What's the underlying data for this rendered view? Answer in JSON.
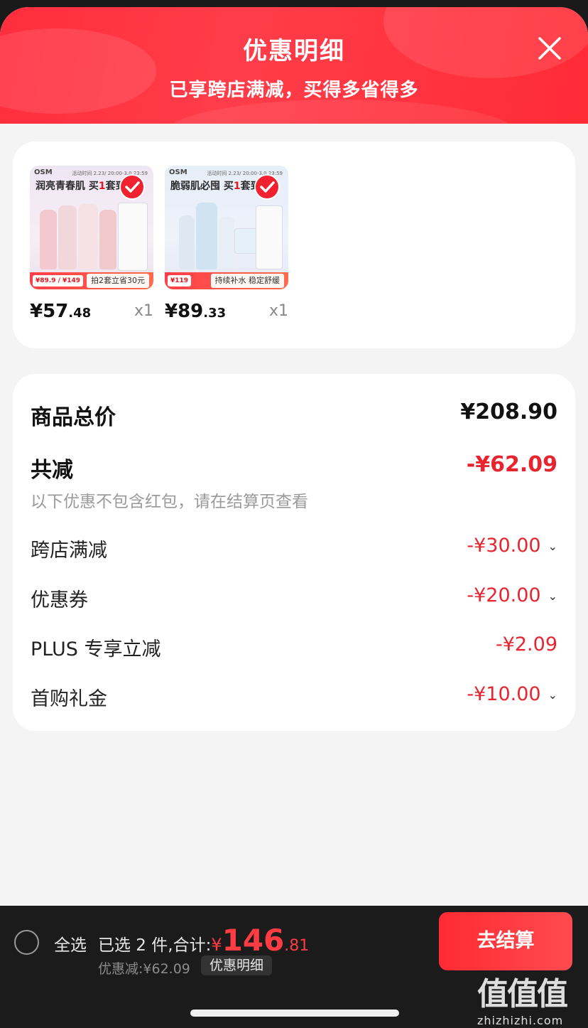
{
  "header": {
    "title": "优惠明细",
    "subtitle": "已享跨店满减，买得多省得多"
  },
  "products": [
    {
      "thumb": {
        "brand": "OSM",
        "date_text": "活动时间 2.23/ 20:00-3.0 23:59",
        "headline": "润亮青春肌 买",
        "headline_num": "1",
        "headline_tail": "套到手",
        "price_tag": "¥89.9 / ¥149",
        "sub_tag": "拍2套立省30元"
      },
      "price_int": "¥57",
      "price_dec": ".48",
      "qty": "x1",
      "selected": true
    },
    {
      "thumb": {
        "brand": "OSM",
        "date_text": "活动时间 2.23/ 20:00-3.0 23:59",
        "headline": "脆弱肌必囤 买",
        "headline_num": "1",
        "headline_tail": "套到手",
        "price_tag": "¥119",
        "sub_tag": "持续补水 稳定舒缓"
      },
      "price_int": "¥89",
      "price_dec": ".33",
      "qty": "x1",
      "selected": true
    }
  ],
  "summary": {
    "total_label": "商品总价",
    "total_value": "¥208.90",
    "reduce_label": "共减",
    "reduce_value": "-¥62.09",
    "note": "以下优惠不包含红包，请在结算页查看",
    "items": [
      {
        "label": "跨店满减",
        "value": "-¥30.00",
        "expandable": true
      },
      {
        "label": "优惠券",
        "value": "-¥20.00",
        "expandable": true
      },
      {
        "label": "PLUS 专享立减",
        "value": "-¥2.09",
        "expandable": false
      },
      {
        "label": "首购礼金",
        "value": "-¥10.00",
        "expandable": true
      }
    ]
  },
  "bottom_bar": {
    "select_all": "全选",
    "selected_prefix": "已选 2 件,合计:",
    "total_yen": "¥",
    "total_int": "146",
    "total_dec": ".81",
    "discount_text": "优惠减:¥62.09",
    "detail_label": "优惠明细",
    "checkout_label": "去结算"
  },
  "watermark": {
    "big": "值值值",
    "small": "zhizhizhi.com"
  },
  "colors": {
    "accent": "#ff2d3d",
    "discount_text": "#e8252e",
    "bar_bg": "#1b1b1b"
  }
}
